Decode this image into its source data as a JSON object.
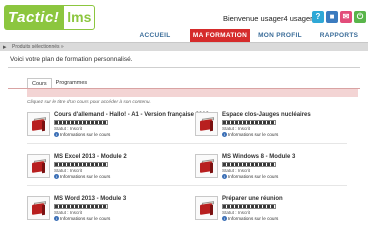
{
  "header": {
    "logo_main": "Tactic!",
    "logo_suffix": "lms",
    "welcome": "Bienvenue usager4 usager4",
    "icons": [
      {
        "name": "help-icon",
        "glyph": "?",
        "color": "#2fa8d6"
      },
      {
        "name": "profile-icon",
        "glyph": "■",
        "color": "#3b7bbf"
      },
      {
        "name": "messages-icon",
        "glyph": "✉",
        "color": "#e24c7a"
      },
      {
        "name": "power-icon",
        "glyph": "⏻",
        "color": "#59b54a"
      }
    ],
    "accent_color": "#d52b2b"
  },
  "nav": {
    "items": [
      {
        "label": "ACCUEIL",
        "active": false
      },
      {
        "label": "MA FORMATION",
        "active": true
      },
      {
        "label": "MON PROFIL",
        "active": false
      },
      {
        "label": "RAPPORTS",
        "active": false
      }
    ]
  },
  "subbar": {
    "text": "Produits sélectionnés »"
  },
  "main": {
    "intro": "Voici votre plan de formation personnalisé.",
    "tabs": [
      {
        "label": "Cours",
        "active": true
      },
      {
        "label": "Programmes",
        "active": false
      }
    ],
    "hint": "Cliquez sur le titre d'un cours pour accéder à son contenu.",
    "courses": [
      {
        "title": "Cours d'allemand - Hallo! - A1 - Version française 2013",
        "status": "Statut : Inscrit",
        "info": "Informations sur le cours"
      },
      {
        "title": "Espace clos-Jauges nucléaires",
        "status": "Statut : Inscrit",
        "info": "Informations sur le cours"
      },
      {
        "title": "MS Excel 2013 - Module 2",
        "status": "Statut : Inscrit",
        "info": "Informations sur le cours"
      },
      {
        "title": "MS Windows 8 - Module 3",
        "status": "Statut : Inscrit",
        "info": "Informations sur le cours"
      },
      {
        "title": "MS Word 2013 - Module 3",
        "status": "Statut : Inscrit",
        "info": "Informations sur le cours"
      },
      {
        "title": "Préparer une réunion",
        "status": "Statut : Inscrit",
        "info": "Informations sur le cours"
      }
    ]
  }
}
